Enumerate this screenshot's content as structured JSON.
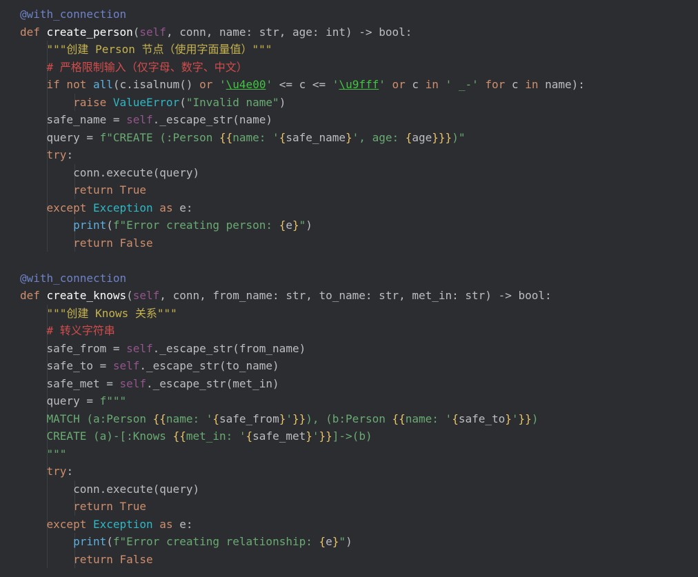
{
  "editor": {
    "lines": [
      [
        [
          "dec2",
          "@with_connection"
        ]
      ],
      [
        [
          "kw",
          "def "
        ],
        [
          "fdef",
          "create_person"
        ],
        [
          "plain",
          "("
        ],
        [
          "self",
          "self"
        ],
        [
          "plain",
          ", conn, name: str, age: int) -> bool:"
        ]
      ],
      [
        [
          "plain",
          "    "
        ],
        [
          "doc",
          "\"\"\"创建 Person 节点（使用字面量值）\"\"\""
        ]
      ],
      [
        [
          "plain",
          "    "
        ],
        [
          "cmt",
          "# 严格限制输入（仅字母、数字、中文）"
        ]
      ],
      [
        [
          "plain",
          "    "
        ],
        [
          "kw",
          "if not "
        ],
        [
          "bi",
          "all"
        ],
        [
          "plain",
          "(c.isalnum() "
        ],
        [
          "kw",
          "or "
        ],
        [
          "str",
          "'"
        ],
        [
          "esc",
          "\\u4e00"
        ],
        [
          "str",
          "'"
        ],
        [
          "plain",
          " <= c <= "
        ],
        [
          "str",
          "'"
        ],
        [
          "esc",
          "\\u9fff"
        ],
        [
          "str",
          "'"
        ],
        [
          "kw",
          " or "
        ],
        [
          "plain",
          "c "
        ],
        [
          "kw",
          "in "
        ],
        [
          "str",
          "' _-'"
        ],
        [
          "kw",
          " for "
        ],
        [
          "plain",
          "c "
        ],
        [
          "kw",
          "in "
        ],
        [
          "plain",
          "name):"
        ]
      ],
      [
        [
          "plain",
          "        "
        ],
        [
          "kw",
          "raise "
        ],
        [
          "cls",
          "ValueError"
        ],
        [
          "plain",
          "("
        ],
        [
          "str",
          "\"Invalid name\""
        ],
        [
          "plain",
          ")"
        ]
      ],
      [
        [
          "plain",
          "    safe_name = "
        ],
        [
          "self",
          "self"
        ],
        [
          "plain",
          "._escape_str(name)"
        ]
      ],
      [
        [
          "plain",
          "    query = "
        ],
        [
          "str",
          "f\"CREATE (:Person "
        ],
        [
          "brace",
          "{{"
        ],
        [
          "str",
          "name: '"
        ],
        [
          "brace",
          "{"
        ],
        [
          "plain",
          "safe_name"
        ],
        [
          "brace",
          "}"
        ],
        [
          "str",
          "', age: "
        ],
        [
          "brace",
          "{"
        ],
        [
          "plain",
          "age"
        ],
        [
          "brace",
          "}}}"
        ],
        [
          "str",
          ")\""
        ]
      ],
      [
        [
          "plain",
          "    "
        ],
        [
          "kw",
          "try"
        ],
        [
          "plain",
          ":"
        ]
      ],
      [
        [
          "plain",
          "        conn.execute(query)"
        ]
      ],
      [
        [
          "plain",
          "        "
        ],
        [
          "kw",
          "return True"
        ]
      ],
      [
        [
          "plain",
          "    "
        ],
        [
          "kw",
          "except "
        ],
        [
          "cls",
          "Exception"
        ],
        [
          "kw",
          " as "
        ],
        [
          "plain",
          "e:"
        ]
      ],
      [
        [
          "plain",
          "        "
        ],
        [
          "bi",
          "print"
        ],
        [
          "plain",
          "("
        ],
        [
          "str",
          "f\"Error creating person: "
        ],
        [
          "brace",
          "{"
        ],
        [
          "plain",
          "e"
        ],
        [
          "brace",
          "}"
        ],
        [
          "str",
          "\""
        ],
        [
          "plain",
          ")"
        ]
      ],
      [
        [
          "plain",
          "        "
        ],
        [
          "kw",
          "return False"
        ]
      ],
      [
        [
          "plain",
          ""
        ]
      ],
      [
        [
          "dec2",
          "@with_connection"
        ]
      ],
      [
        [
          "kw",
          "def "
        ],
        [
          "fdef",
          "create_knows"
        ],
        [
          "plain",
          "("
        ],
        [
          "self",
          "self"
        ],
        [
          "plain",
          ", conn, from_name: str, to_name: str, met_in: str) -> bool:"
        ]
      ],
      [
        [
          "plain",
          "    "
        ],
        [
          "doc",
          "\"\"\"创建 Knows 关系\"\"\""
        ]
      ],
      [
        [
          "plain",
          "    "
        ],
        [
          "cmt",
          "# 转义字符串"
        ]
      ],
      [
        [
          "plain",
          "    safe_from = "
        ],
        [
          "self",
          "self"
        ],
        [
          "plain",
          "._escape_str(from_name)"
        ]
      ],
      [
        [
          "plain",
          "    safe_to = "
        ],
        [
          "self",
          "self"
        ],
        [
          "plain",
          "._escape_str(to_name)"
        ]
      ],
      [
        [
          "plain",
          "    safe_met = "
        ],
        [
          "self",
          "self"
        ],
        [
          "plain",
          "._escape_str(met_in)"
        ]
      ],
      [
        [
          "plain",
          "    query = "
        ],
        [
          "str",
          "f\"\"\""
        ]
      ],
      [
        [
          "plain",
          "    "
        ],
        [
          "str",
          "MATCH (a:Person "
        ],
        [
          "brace",
          "{{"
        ],
        [
          "str",
          "name: '"
        ],
        [
          "brace",
          "{"
        ],
        [
          "plain",
          "safe_from"
        ],
        [
          "brace",
          "}"
        ],
        [
          "str",
          "'"
        ],
        [
          "brace",
          "}}"
        ],
        [
          "str",
          "), (b:Person "
        ],
        [
          "brace",
          "{{"
        ],
        [
          "str",
          "name: '"
        ],
        [
          "brace",
          "{"
        ],
        [
          "plain",
          "safe_to"
        ],
        [
          "brace",
          "}"
        ],
        [
          "str",
          "'"
        ],
        [
          "brace",
          "}}"
        ],
        [
          "str",
          ")"
        ]
      ],
      [
        [
          "plain",
          "    "
        ],
        [
          "str",
          "CREATE (a)-[:Knows "
        ],
        [
          "brace",
          "{{"
        ],
        [
          "str",
          "met_in: '"
        ],
        [
          "brace",
          "{"
        ],
        [
          "plain",
          "safe_met"
        ],
        [
          "brace",
          "}"
        ],
        [
          "str",
          "'"
        ],
        [
          "brace",
          "}}"
        ],
        [
          "str",
          "]->(b)"
        ]
      ],
      [
        [
          "plain",
          "    "
        ],
        [
          "str",
          "\"\"\""
        ]
      ],
      [
        [
          "plain",
          "    "
        ],
        [
          "kw",
          "try"
        ],
        [
          "plain",
          ":"
        ]
      ],
      [
        [
          "plain",
          "        conn.execute(query)"
        ]
      ],
      [
        [
          "plain",
          "        "
        ],
        [
          "kw",
          "return True"
        ]
      ],
      [
        [
          "plain",
          "    "
        ],
        [
          "kw",
          "except "
        ],
        [
          "cls",
          "Exception"
        ],
        [
          "kw",
          " as "
        ],
        [
          "plain",
          "e:"
        ]
      ],
      [
        [
          "plain",
          "        "
        ],
        [
          "bi",
          "print"
        ],
        [
          "plain",
          "("
        ],
        [
          "str",
          "f\"Error creating relationship: "
        ],
        [
          "brace",
          "{"
        ],
        [
          "plain",
          "e"
        ],
        [
          "brace",
          "}"
        ],
        [
          "str",
          "\""
        ],
        [
          "plain",
          ")"
        ]
      ],
      [
        [
          "plain",
          "        "
        ],
        [
          "kw",
          "return False"
        ]
      ]
    ]
  }
}
